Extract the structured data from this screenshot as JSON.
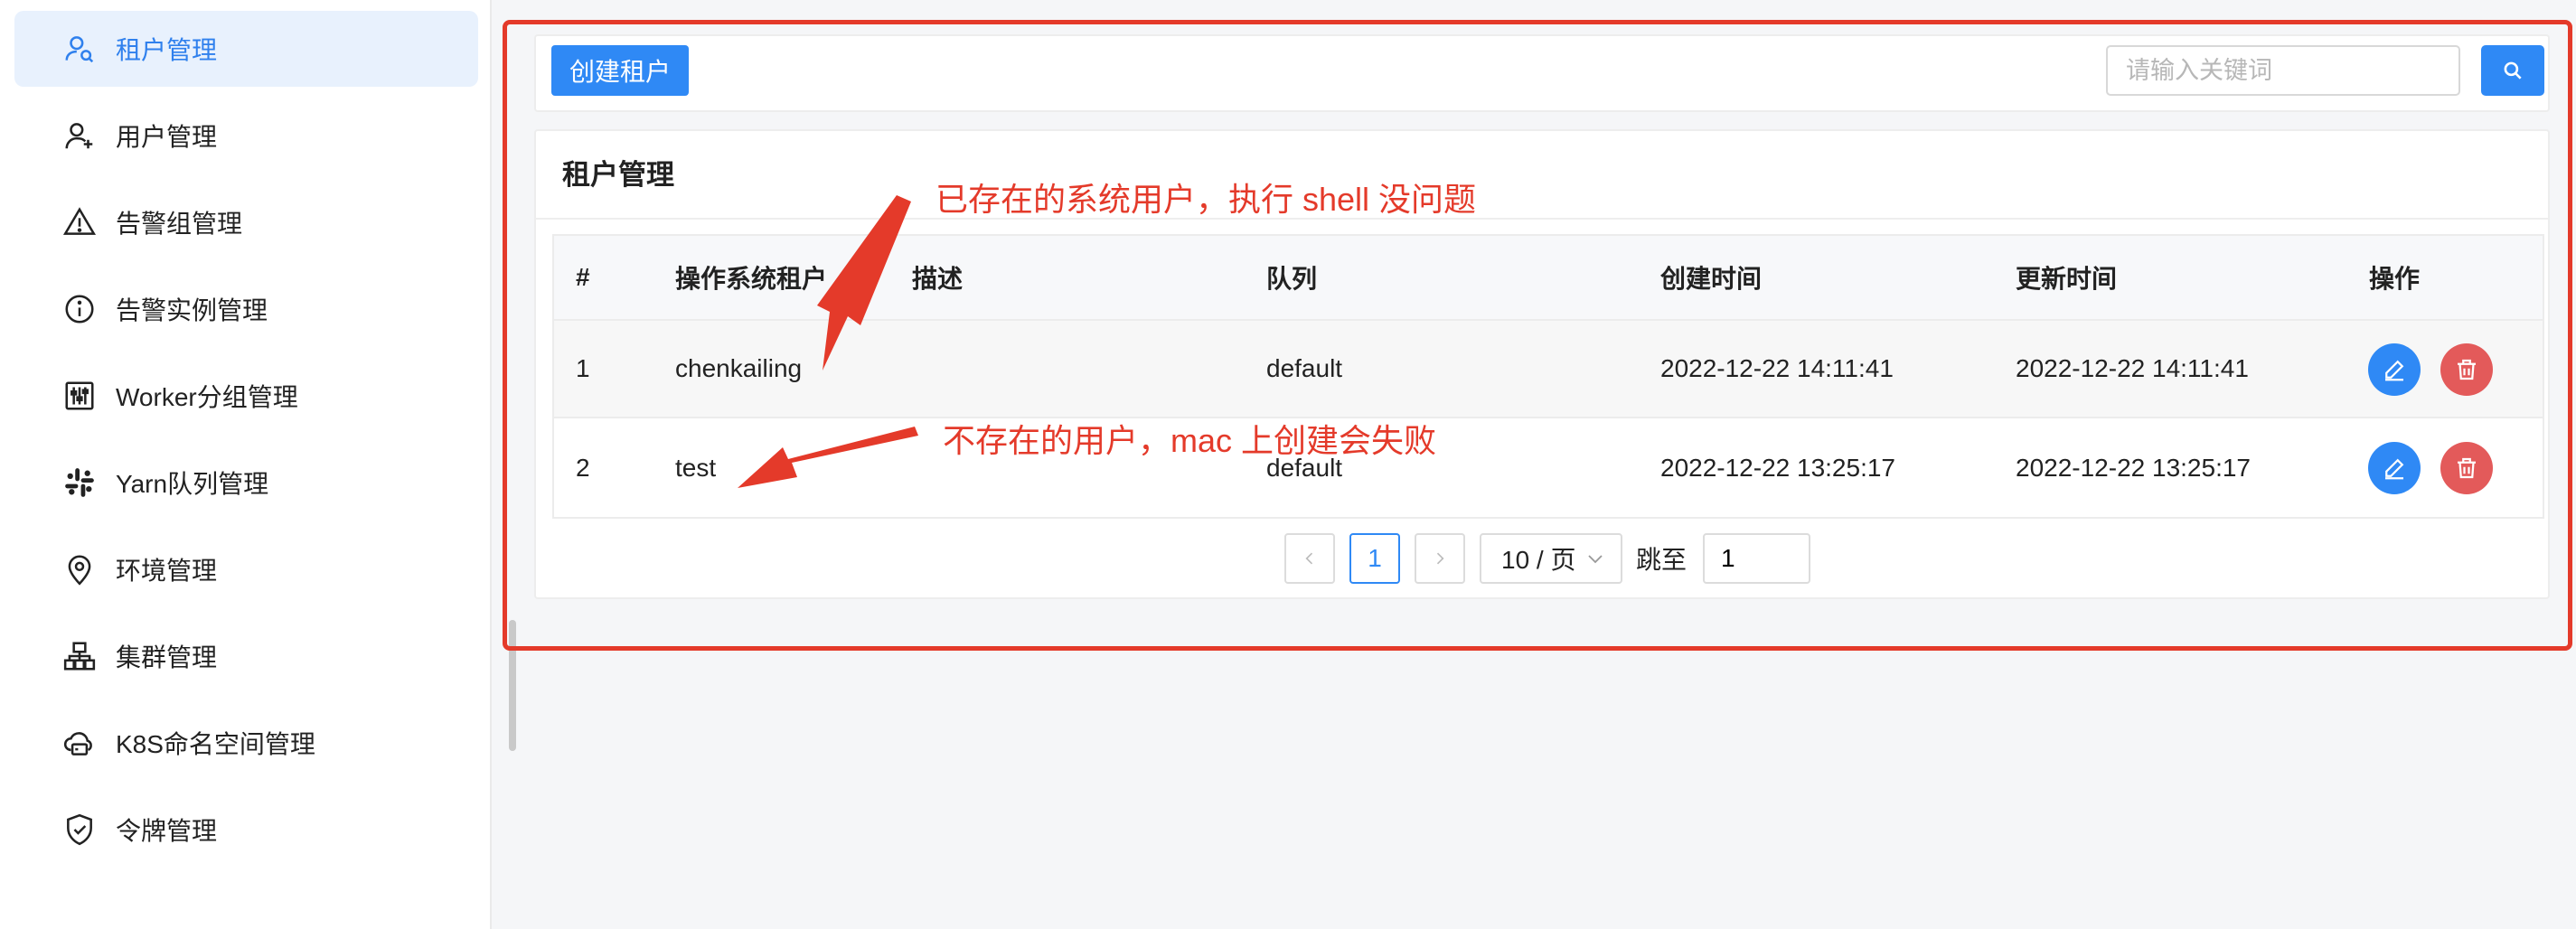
{
  "sidebar": {
    "items": [
      {
        "label": "租户管理",
        "icon": "tenant-icon",
        "active": true
      },
      {
        "label": "用户管理",
        "icon": "user-add-icon"
      },
      {
        "label": "告警组管理",
        "icon": "warning-triangle-icon"
      },
      {
        "label": "告警实例管理",
        "icon": "info-circle-icon"
      },
      {
        "label": "Worker分组管理",
        "icon": "sliders-icon"
      },
      {
        "label": "Yarn队列管理",
        "icon": "slack-icon"
      },
      {
        "label": "环境管理",
        "icon": "location-pin-icon"
      },
      {
        "label": "集群管理",
        "icon": "cluster-icon"
      },
      {
        "label": "K8S命名空间管理",
        "icon": "cloud-server-icon"
      },
      {
        "label": "令牌管理",
        "icon": "shield-check-icon"
      }
    ]
  },
  "toolbar": {
    "create_label": "创建租户",
    "search_placeholder": "请输入关键词",
    "search_value": ""
  },
  "panel": {
    "title": "租户管理"
  },
  "table": {
    "columns": [
      "#",
      "操作系统租户",
      "描述",
      "队列",
      "创建时间",
      "更新时间",
      "操作"
    ],
    "rows": [
      {
        "index": "1",
        "tenant": "chenkailing",
        "description": "",
        "queue": "default",
        "created": "2022-12-22 14:11:41",
        "updated": "2022-12-22 14:11:41"
      },
      {
        "index": "2",
        "tenant": "test",
        "description": "",
        "queue": "default",
        "created": "2022-12-22 13:25:17",
        "updated": "2022-12-22 13:25:17"
      }
    ]
  },
  "pagination": {
    "current_page": "1",
    "page_size": "10 / 页",
    "jump_label": "跳至",
    "jump_value": "1"
  },
  "annotations": {
    "top": "已存在的系统用户，执行 shell 没问题",
    "bottom": "不存在的用户，mac 上创建会失败"
  },
  "colors": {
    "primary": "#2f89f5",
    "danger": "#e35a5a",
    "annotation": "#e43a2a",
    "active_nav_bg": "#e8f1fd"
  }
}
